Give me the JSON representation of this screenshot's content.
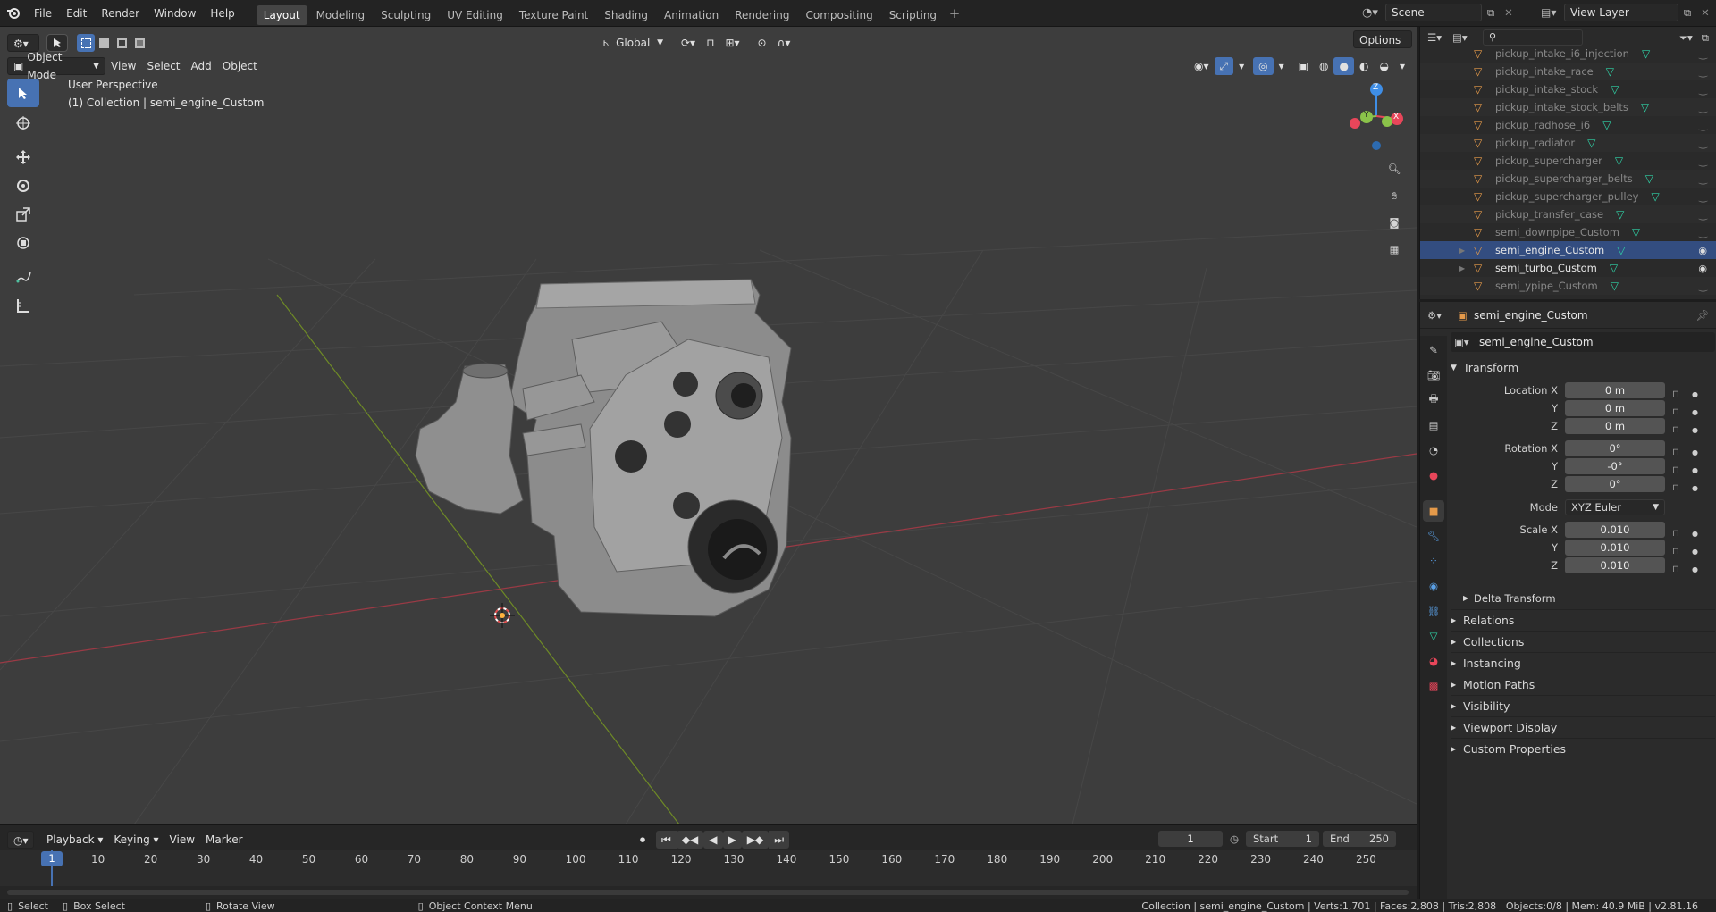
{
  "topbar": {
    "menus": [
      "File",
      "Edit",
      "Render",
      "Window",
      "Help"
    ],
    "workspaces": [
      "Layout",
      "Modeling",
      "Sculpting",
      "UV Editing",
      "Texture Paint",
      "Shading",
      "Animation",
      "Rendering",
      "Compositing",
      "Scripting"
    ],
    "active_workspace": "Layout",
    "scene": "Scene",
    "view_layer": "View Layer"
  },
  "viewport": {
    "mode": "Object Mode",
    "menus": [
      "View",
      "Select",
      "Add",
      "Object"
    ],
    "transform_orientation": "Global",
    "options_label": "Options",
    "overlay_title": "User Perspective",
    "overlay_subtitle": "(1) Collection | semi_engine_Custom",
    "gizmo_axes": {
      "x": "X",
      "y": "Y",
      "z": "Z"
    }
  },
  "outliner": {
    "items": [
      {
        "label": "pickup_intake_i6_injection",
        "selected": false,
        "visible": false
      },
      {
        "label": "pickup_intake_race",
        "selected": false,
        "visible": false
      },
      {
        "label": "pickup_intake_stock",
        "selected": false,
        "visible": false
      },
      {
        "label": "pickup_intake_stock_belts",
        "selected": false,
        "visible": false
      },
      {
        "label": "pickup_radhose_i6",
        "selected": false,
        "visible": false
      },
      {
        "label": "pickup_radiator",
        "selected": false,
        "visible": false
      },
      {
        "label": "pickup_supercharger",
        "selected": false,
        "visible": false
      },
      {
        "label": "pickup_supercharger_belts",
        "selected": false,
        "visible": false
      },
      {
        "label": "pickup_supercharger_pulley",
        "selected": false,
        "visible": false
      },
      {
        "label": "pickup_transfer_case",
        "selected": false,
        "visible": false
      },
      {
        "label": "semi_downpipe_Custom",
        "selected": false,
        "visible": false
      },
      {
        "label": "semi_engine_Custom",
        "selected": true,
        "visible": true
      },
      {
        "label": "semi_turbo_Custom",
        "selected": false,
        "visible": true
      },
      {
        "label": "semi_ypipe_Custom",
        "selected": false,
        "visible": false
      }
    ]
  },
  "properties": {
    "header_object": "semi_engine_Custom",
    "object_name": "semi_engine_Custom",
    "transform_title": "Transform",
    "location_label": "Location X",
    "rotation_label": "Rotation X",
    "scale_label": "Scale X",
    "y_label": "Y",
    "z_label": "Z",
    "location": [
      "0 m",
      "0 m",
      "0 m"
    ],
    "rotation": [
      "0°",
      "-0°",
      "0°"
    ],
    "mode_label": "Mode",
    "mode_value": "XYZ Euler",
    "scale": [
      "0.010",
      "0.010",
      "0.010"
    ],
    "delta_transform": "Delta Transform",
    "panels": [
      "Relations",
      "Collections",
      "Instancing",
      "Motion Paths",
      "Visibility",
      "Viewport Display",
      "Custom Properties"
    ]
  },
  "timeline": {
    "menus": [
      "Playback",
      "Keying",
      "View",
      "Marker"
    ],
    "current_frame": "1",
    "start_label": "Start",
    "start_value": "1",
    "end_label": "End",
    "end_value": "250",
    "ticks": [
      "1",
      "10",
      "20",
      "30",
      "40",
      "50",
      "60",
      "70",
      "80",
      "90",
      "100",
      "110",
      "120",
      "130",
      "140",
      "150",
      "160",
      "170",
      "180",
      "190",
      "200",
      "210",
      "220",
      "230",
      "240",
      "250"
    ]
  },
  "statusbar": {
    "select": "Select",
    "box_select": "Box Select",
    "rotate_view": "Rotate View",
    "context_menu": "Object Context Menu",
    "stats": "Collection | semi_engine_Custom | Verts:1,701 | Faces:2,808 | Tris:2,808 | Objects:0/8 | Mem: 40.9 MiB | v2.81.16"
  },
  "colors": {
    "accent": "#4772b3",
    "axis_x": "#e8465a",
    "axis_y": "#8bc34a",
    "axis_z": "#3f8ee6",
    "mesh_icon": "#2fd3a7",
    "object_icon": "#e59a4a"
  }
}
